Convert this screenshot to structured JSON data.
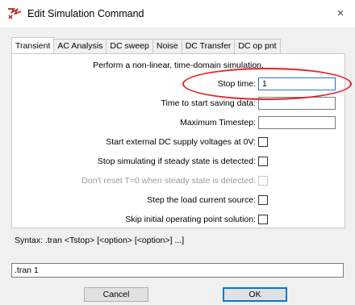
{
  "window": {
    "title": "Edit Simulation Command",
    "close_glyph": "×",
    "icon": "ltspice-app-icon"
  },
  "tabs": [
    {
      "label": "Transient",
      "active": true
    },
    {
      "label": "AC Analysis",
      "active": false
    },
    {
      "label": "DC sweep",
      "active": false
    },
    {
      "label": "Noise",
      "active": false
    },
    {
      "label": "DC Transfer",
      "active": false
    },
    {
      "label": "DC op pnt",
      "active": false
    }
  ],
  "transient": {
    "description": "Perform a non-linear, time-domain simulation.",
    "stop_time": {
      "label": "Stop time:",
      "value": "1"
    },
    "start_saving": {
      "label": "Time to start saving data:",
      "value": ""
    },
    "max_timestep": {
      "label": "Maximum Timestep:",
      "value": ""
    },
    "start_ext_dc": {
      "label": "Start external DC supply voltages at 0V:",
      "checked": false
    },
    "stop_steady": {
      "label": "Stop simulating if steady state is detected:",
      "checked": false
    },
    "dont_reset": {
      "label": "Don't reset T=0 when steady state is detected:",
      "checked": false,
      "disabled": true
    },
    "step_load": {
      "label": "Step the load current source:",
      "checked": false
    },
    "skip_op": {
      "label": "Skip initial operating point solution:",
      "checked": false
    }
  },
  "syntax": "Syntax: .tran <Tstop> [<option> [<option>] ...]",
  "command": ".tran 1",
  "buttons": {
    "cancel": "Cancel",
    "ok": "OK"
  },
  "colors": {
    "annotation": "#e0222a",
    "focus_border": "#2b6fd6",
    "dialog_bg": "#f0f0f0"
  }
}
